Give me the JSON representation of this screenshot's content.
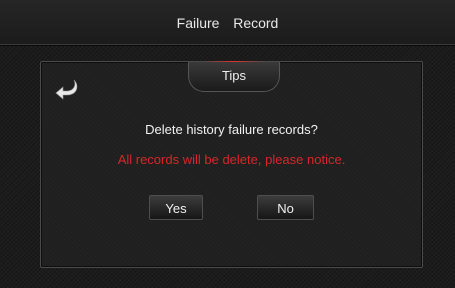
{
  "header": {
    "title": "Failure  Record"
  },
  "dialog": {
    "tab_label": "Tips",
    "back_icon": "back-arrow-icon",
    "question": "Delete history failure records?",
    "notice": "All records will be delete, please notice.",
    "yes_label": "Yes",
    "no_label": "No"
  },
  "colors": {
    "background": "#1c1c1c",
    "text": "#f0f0f0",
    "warning": "#d8262a",
    "accent": "#e0322c"
  }
}
